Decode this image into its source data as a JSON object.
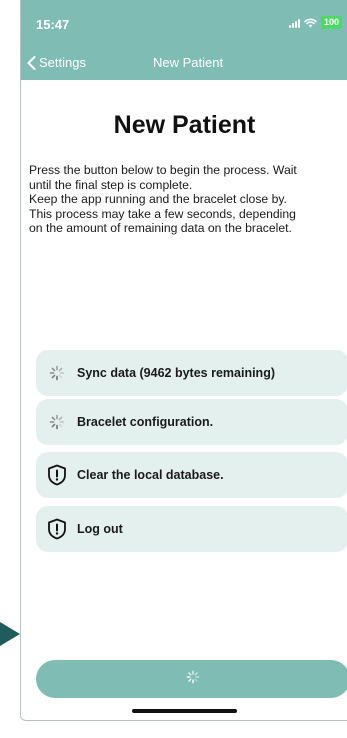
{
  "status_bar": {
    "time": "15:47",
    "battery": "100"
  },
  "nav": {
    "back_label": "Settings",
    "title": "New Patient"
  },
  "page": {
    "title": "New Patient",
    "intro_lines": [
      "Press the button below to begin the process. Wait",
      "until the final step is complete.",
      "Keep the app running and the bracelet close by.",
      "This process may take a few seconds, depending",
      "on the amount of remaining data on the bracelet."
    ]
  },
  "steps": [
    {
      "label": "Sync data (9462 bytes remaining)",
      "icon": "spinner-icon"
    },
    {
      "label": "Bracelet configuration.",
      "icon": "spinner-icon"
    },
    {
      "label": "Clear the local database.",
      "icon": "shield-exclamation-icon"
    },
    {
      "label": "Log out",
      "icon": "shield-exclamation-icon"
    }
  ],
  "colors": {
    "header": "#7fbcb3",
    "step_background": "#e4f0ee",
    "button": "#7fbcb3",
    "annotation_arrow": "#1f5c5c"
  }
}
